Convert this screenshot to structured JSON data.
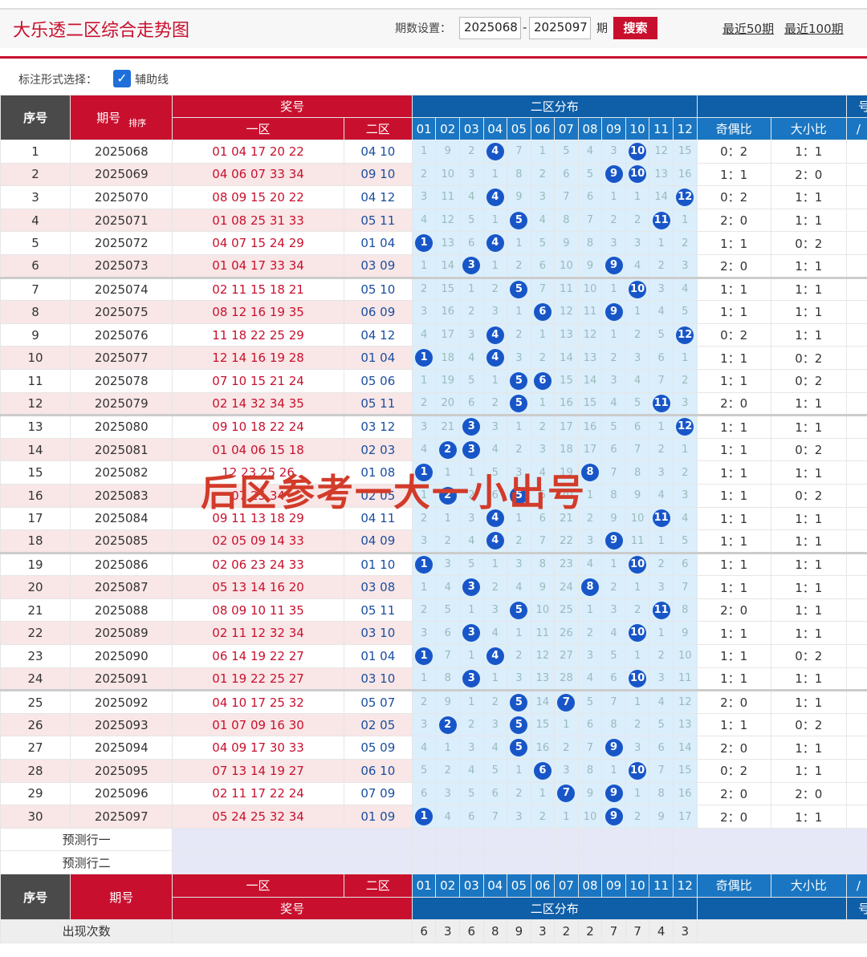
{
  "header": {
    "title": "大乐透二区综合走势图",
    "period_label": "期数设置：",
    "from": "2025068",
    "to": "2025097",
    "period_unit": "期",
    "search": "搜索",
    "link50": "最近50期",
    "link100": "最近100期"
  },
  "options": {
    "label": "标注形式选择：",
    "aux": "辅助线"
  },
  "table": {
    "h_seq": "序号",
    "h_issue": "期号",
    "h_sort": "排序",
    "h_prize": "奖号",
    "h_zone1": "一区",
    "h_zone2": "二区",
    "h_dist": "二区分布",
    "h_odd": "奇偶比",
    "h_big": "大小比",
    "h_more": "号",
    "cols": [
      "01",
      "02",
      "03",
      "04",
      "05",
      "06",
      "07",
      "08",
      "09",
      "10",
      "11",
      "12"
    ],
    "rows": [
      {
        "seq": "1",
        "issue": "2025068",
        "z1": "01 04 17 20 22",
        "z2": "04 10",
        "d": [
          "1",
          "9",
          "2",
          "4",
          "7",
          "1",
          "5",
          "4",
          "3",
          "10",
          "12",
          "15"
        ],
        "hit": [
          3,
          9
        ],
        "odd": "0：2",
        "big": "1：1"
      },
      {
        "seq": "2",
        "issue": "2025069",
        "z1": "04 06 07 33 34",
        "z2": "09 10",
        "d": [
          "2",
          "10",
          "3",
          "1",
          "8",
          "2",
          "6",
          "5",
          "9",
          "10",
          "13",
          "16"
        ],
        "hit": [
          8,
          9
        ],
        "odd": "1：1",
        "big": "2：0"
      },
      {
        "seq": "3",
        "issue": "2025070",
        "z1": "08 09 15 20 22",
        "z2": "04 12",
        "d": [
          "3",
          "11",
          "4",
          "4",
          "9",
          "3",
          "7",
          "6",
          "1",
          "1",
          "14",
          "12"
        ],
        "hit": [
          3,
          11
        ],
        "odd": "0：2",
        "big": "1：1"
      },
      {
        "seq": "4",
        "issue": "2025071",
        "z1": "01 08 25 31 33",
        "z2": "05 11",
        "d": [
          "4",
          "12",
          "5",
          "1",
          "5",
          "4",
          "8",
          "7",
          "2",
          "2",
          "11",
          "1"
        ],
        "hit": [
          4,
          10
        ],
        "odd": "2：0",
        "big": "1：1"
      },
      {
        "seq": "5",
        "issue": "2025072",
        "z1": "04 07 15 24 29",
        "z2": "01 04",
        "d": [
          "1",
          "13",
          "6",
          "4",
          "1",
          "5",
          "9",
          "8",
          "3",
          "3",
          "1",
          "2"
        ],
        "hit": [
          0,
          3
        ],
        "odd": "1：1",
        "big": "0：2"
      },
      {
        "seq": "6",
        "issue": "2025073",
        "z1": "01 04 17 33 34",
        "z2": "03 09",
        "d": [
          "1",
          "14",
          "3",
          "1",
          "2",
          "6",
          "10",
          "9",
          "9",
          "4",
          "2",
          "3"
        ],
        "hit": [
          2,
          8
        ],
        "odd": "2：0",
        "big": "1：1"
      },
      {
        "seq": "7",
        "issue": "2025074",
        "z1": "02 11 15 18 21",
        "z2": "05 10",
        "d": [
          "2",
          "15",
          "1",
          "2",
          "5",
          "7",
          "11",
          "10",
          "1",
          "10",
          "3",
          "4"
        ],
        "hit": [
          4,
          9
        ],
        "odd": "1：1",
        "big": "1：1"
      },
      {
        "seq": "8",
        "issue": "2025075",
        "z1": "08 12 16 19 35",
        "z2": "06 09",
        "d": [
          "3",
          "16",
          "2",
          "3",
          "1",
          "6",
          "12",
          "11",
          "9",
          "1",
          "4",
          "5"
        ],
        "hit": [
          5,
          8
        ],
        "odd": "1：1",
        "big": "1：1"
      },
      {
        "seq": "9",
        "issue": "2025076",
        "z1": "11 18 22 25 29",
        "z2": "04 12",
        "d": [
          "4",
          "17",
          "3",
          "4",
          "2",
          "1",
          "13",
          "12",
          "1",
          "2",
          "5",
          "12"
        ],
        "hit": [
          3,
          11
        ],
        "odd": "0：2",
        "big": "1：1"
      },
      {
        "seq": "10",
        "issue": "2025077",
        "z1": "12 14 16 19 28",
        "z2": "01 04",
        "d": [
          "1",
          "18",
          "4",
          "4",
          "3",
          "2",
          "14",
          "13",
          "2",
          "3",
          "6",
          "1"
        ],
        "hit": [
          0,
          3
        ],
        "odd": "1：1",
        "big": "0：2"
      },
      {
        "seq": "11",
        "issue": "2025078",
        "z1": "07 10 15 21 24",
        "z2": "05 06",
        "d": [
          "1",
          "19",
          "5",
          "1",
          "5",
          "6",
          "15",
          "14",
          "3",
          "4",
          "7",
          "2"
        ],
        "hit": [
          4,
          5
        ],
        "odd": "1：1",
        "big": "0：2"
      },
      {
        "seq": "12",
        "issue": "2025079",
        "z1": "02 14 32 34 35",
        "z2": "05 11",
        "d": [
          "2",
          "20",
          "6",
          "2",
          "5",
          "1",
          "16",
          "15",
          "4",
          "5",
          "11",
          "3"
        ],
        "hit": [
          4,
          10
        ],
        "odd": "2：0",
        "big": "1：1"
      },
      {
        "seq": "13",
        "issue": "2025080",
        "z1": "09 10 18 22 24",
        "z2": "03 12",
        "d": [
          "3",
          "21",
          "3",
          "3",
          "1",
          "2",
          "17",
          "16",
          "5",
          "6",
          "1",
          "12"
        ],
        "hit": [
          2,
          11
        ],
        "odd": "1：1",
        "big": "1：1"
      },
      {
        "seq": "14",
        "issue": "2025081",
        "z1": "01 04 06 15 18",
        "z2": "02 03",
        "d": [
          "4",
          "2",
          "3",
          "4",
          "2",
          "3",
          "18",
          "17",
          "6",
          "7",
          "2",
          "1"
        ],
        "hit": [
          1,
          2
        ],
        "odd": "1：1",
        "big": "0：2"
      },
      {
        "seq": "15",
        "issue": "2025082",
        "z1": "12 23 25 26",
        "z2": "01 08",
        "d": [
          "1",
          "1",
          "1",
          "5",
          "3",
          "4",
          "19",
          "8",
          "7",
          "8",
          "3",
          "2"
        ],
        "hit": [
          0,
          7
        ],
        "odd": "1：1",
        "big": "1：1"
      },
      {
        "seq": "16",
        "issue": "2025083",
        "z1": "07 25 34",
        "z2": "02 05",
        "d": [
          "1",
          "2",
          "2",
          "6",
          "5",
          "5",
          "20",
          "1",
          "8",
          "9",
          "4",
          "3"
        ],
        "hit": [
          1,
          4
        ],
        "odd": "1：1",
        "big": "0：2"
      },
      {
        "seq": "17",
        "issue": "2025084",
        "z1": "09 11 13 18 29",
        "z2": "04 11",
        "d": [
          "2",
          "1",
          "3",
          "4",
          "1",
          "6",
          "21",
          "2",
          "9",
          "10",
          "11",
          "4"
        ],
        "hit": [
          3,
          10
        ],
        "odd": "1：1",
        "big": "1：1"
      },
      {
        "seq": "18",
        "issue": "2025085",
        "z1": "02 05 09 14 33",
        "z2": "04 09",
        "d": [
          "3",
          "2",
          "4",
          "4",
          "2",
          "7",
          "22",
          "3",
          "9",
          "11",
          "1",
          "5"
        ],
        "hit": [
          3,
          8
        ],
        "odd": "1：1",
        "big": "1：1"
      },
      {
        "seq": "19",
        "issue": "2025086",
        "z1": "02 06 23 24 33",
        "z2": "01 10",
        "d": [
          "1",
          "3",
          "5",
          "1",
          "3",
          "8",
          "23",
          "4",
          "1",
          "10",
          "2",
          "6"
        ],
        "hit": [
          0,
          9
        ],
        "odd": "1：1",
        "big": "1：1"
      },
      {
        "seq": "20",
        "issue": "2025087",
        "z1": "05 13 14 16 20",
        "z2": "03 08",
        "d": [
          "1",
          "4",
          "3",
          "2",
          "4",
          "9",
          "24",
          "8",
          "2",
          "1",
          "3",
          "7"
        ],
        "hit": [
          2,
          7
        ],
        "odd": "1：1",
        "big": "1：1"
      },
      {
        "seq": "21",
        "issue": "2025088",
        "z1": "08 09 10 11 35",
        "z2": "05 11",
        "d": [
          "2",
          "5",
          "1",
          "3",
          "5",
          "10",
          "25",
          "1",
          "3",
          "2",
          "11",
          "8"
        ],
        "hit": [
          4,
          10
        ],
        "odd": "2：0",
        "big": "1：1"
      },
      {
        "seq": "22",
        "issue": "2025089",
        "z1": "02 11 12 32 34",
        "z2": "03 10",
        "d": [
          "3",
          "6",
          "3",
          "4",
          "1",
          "11",
          "26",
          "2",
          "4",
          "10",
          "1",
          "9"
        ],
        "hit": [
          2,
          9
        ],
        "odd": "1：1",
        "big": "1：1"
      },
      {
        "seq": "23",
        "issue": "2025090",
        "z1": "06 14 19 22 27",
        "z2": "01 04",
        "d": [
          "1",
          "7",
          "1",
          "4",
          "2",
          "12",
          "27",
          "3",
          "5",
          "1",
          "2",
          "10"
        ],
        "hit": [
          0,
          3
        ],
        "odd": "1：1",
        "big": "0：2"
      },
      {
        "seq": "24",
        "issue": "2025091",
        "z1": "01 19 22 25 27",
        "z2": "03 10",
        "d": [
          "1",
          "8",
          "3",
          "1",
          "3",
          "13",
          "28",
          "4",
          "6",
          "10",
          "3",
          "11"
        ],
        "hit": [
          2,
          9
        ],
        "odd": "1：1",
        "big": "1：1"
      },
      {
        "seq": "25",
        "issue": "2025092",
        "z1": "04 10 17 25 32",
        "z2": "05 07",
        "d": [
          "2",
          "9",
          "1",
          "2",
          "5",
          "14",
          "7",
          "5",
          "7",
          "1",
          "4",
          "12"
        ],
        "hit": [
          4,
          6
        ],
        "odd": "2：0",
        "big": "1：1"
      },
      {
        "seq": "26",
        "issue": "2025093",
        "z1": "01 07 09 16 30",
        "z2": "02 05",
        "d": [
          "3",
          "2",
          "2",
          "3",
          "5",
          "15",
          "1",
          "6",
          "8",
          "2",
          "5",
          "13"
        ],
        "hit": [
          1,
          4
        ],
        "odd": "1：1",
        "big": "0：2"
      },
      {
        "seq": "27",
        "issue": "2025094",
        "z1": "04 09 17 30 33",
        "z2": "05 09",
        "d": [
          "4",
          "1",
          "3",
          "4",
          "5",
          "16",
          "2",
          "7",
          "9",
          "3",
          "6",
          "14"
        ],
        "hit": [
          4,
          8
        ],
        "odd": "2：0",
        "big": "1：1"
      },
      {
        "seq": "28",
        "issue": "2025095",
        "z1": "07 13 14 19 27",
        "z2": "06 10",
        "d": [
          "5",
          "2",
          "4",
          "5",
          "1",
          "6",
          "3",
          "8",
          "1",
          "10",
          "7",
          "15"
        ],
        "hit": [
          5,
          9
        ],
        "odd": "0：2",
        "big": "1：1"
      },
      {
        "seq": "29",
        "issue": "2025096",
        "z1": "02 11 17 22 24",
        "z2": "07 09",
        "d": [
          "6",
          "3",
          "5",
          "6",
          "2",
          "1",
          "7",
          "9",
          "9",
          "1",
          "8",
          "16"
        ],
        "hit": [
          6,
          8
        ],
        "odd": "2：0",
        "big": "2：0"
      },
      {
        "seq": "30",
        "issue": "2025097",
        "z1": "05 24 25 32 34",
        "z2": "01 09",
        "d": [
          "1",
          "4",
          "6",
          "7",
          "3",
          "2",
          "1",
          "10",
          "9",
          "2",
          "9",
          "17"
        ],
        "hit": [
          0,
          8
        ],
        "odd": "2：0",
        "big": "1：1"
      }
    ],
    "pred1": "预测行一",
    "pred2": "预测行二",
    "count_label": "出现次数",
    "counts": [
      "6",
      "3",
      "6",
      "8",
      "9",
      "3",
      "2",
      "2",
      "7",
      "7",
      "4",
      "3"
    ]
  },
  "overlay": "后区参考一大一小出号"
}
